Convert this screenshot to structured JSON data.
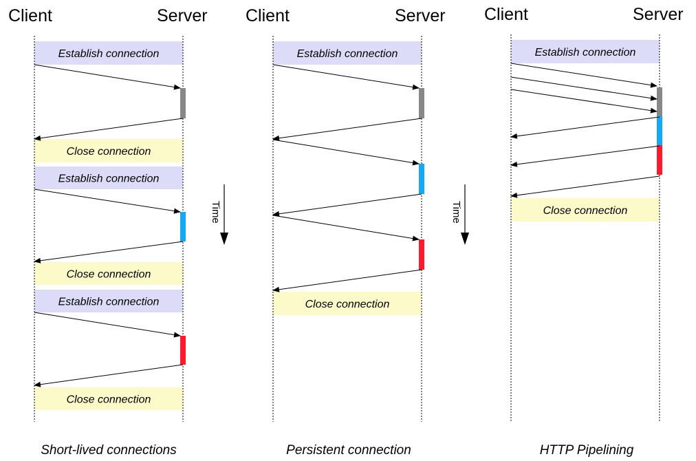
{
  "colors": {
    "establish_box": "#dcdcf8",
    "close_box": "#fbfac8",
    "processing_gray": "#888888",
    "processing_blue": "#15a8f5",
    "processing_red": "#ff1a2e",
    "line": "#000000"
  },
  "time_arrow": {
    "label": "Time"
  },
  "panels": [
    {
      "id": "short-lived",
      "client_label": "Client",
      "server_label": "Server",
      "caption": "Short-lived connections",
      "boxes": [
        {
          "kind": "establish",
          "label": "Establish connection"
        },
        {
          "kind": "close",
          "label": "Close connection"
        },
        {
          "kind": "establish",
          "label": "Establish connection"
        },
        {
          "kind": "close",
          "label": "Close connection"
        },
        {
          "kind": "establish",
          "label": "Establish connection"
        },
        {
          "kind": "close",
          "label": "Close connection"
        }
      ],
      "requests": [
        {
          "name": "request-1",
          "color": "gray"
        },
        {
          "name": "request-2",
          "color": "blue"
        },
        {
          "name": "request-3",
          "color": "red"
        }
      ]
    },
    {
      "id": "persistent",
      "client_label": "Client",
      "server_label": "Server",
      "caption": "Persistent connection",
      "boxes": [
        {
          "kind": "establish",
          "label": "Establish connection"
        },
        {
          "kind": "close",
          "label": "Close connection"
        }
      ],
      "requests": [
        {
          "name": "request-1",
          "color": "gray"
        },
        {
          "name": "request-2",
          "color": "blue"
        },
        {
          "name": "request-3",
          "color": "red"
        }
      ]
    },
    {
      "id": "pipelining",
      "client_label": "Client",
      "server_label": "Server",
      "caption": "HTTP Pipelining",
      "boxes": [
        {
          "kind": "establish",
          "label": "Establish connection"
        },
        {
          "kind": "close",
          "label": "Close connection"
        }
      ],
      "requests": [
        {
          "name": "request-1",
          "color": "gray"
        },
        {
          "name": "request-2",
          "color": "blue"
        },
        {
          "name": "request-3",
          "color": "red"
        }
      ]
    }
  ]
}
